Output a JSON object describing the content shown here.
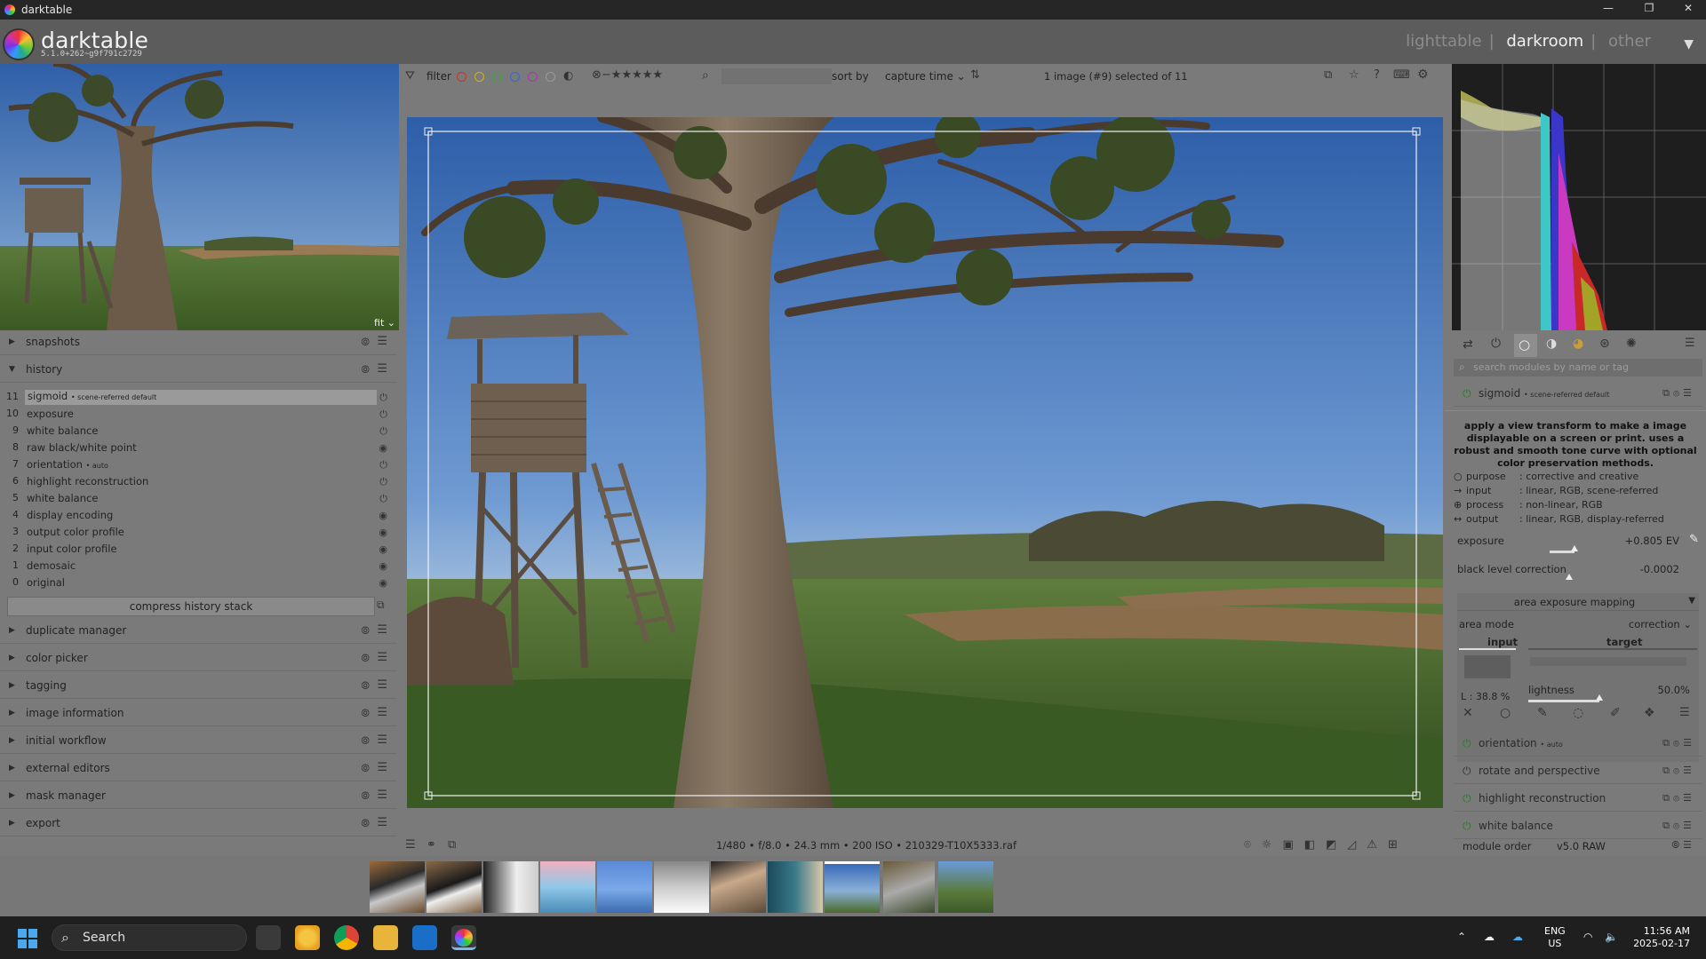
{
  "window": {
    "title": "darktable",
    "controls": [
      "—",
      "❐",
      "✕"
    ]
  },
  "header": {
    "app_name": "darktable",
    "version": "5.1.0+262~g9f791c2729",
    "views": [
      "lighttable",
      "darkroom",
      "other"
    ],
    "active_view": "darkroom"
  },
  "navigation": {
    "zoom": "fit"
  },
  "left_panel": {
    "modules_top": [
      {
        "label": "snapshots"
      },
      {
        "label": "history"
      }
    ],
    "history": [
      {
        "n": "11",
        "label": "sigmoid",
        "sub": "• scene-referred default"
      },
      {
        "n": "10",
        "label": "exposure",
        "sub": ""
      },
      {
        "n": "9",
        "label": "white balance",
        "sub": ""
      },
      {
        "n": "8",
        "label": "raw black/white point",
        "sub": ""
      },
      {
        "n": "7",
        "label": "orientation",
        "sub": "• auto"
      },
      {
        "n": "6",
        "label": "highlight reconstruction",
        "sub": ""
      },
      {
        "n": "5",
        "label": "white balance",
        "sub": ""
      },
      {
        "n": "4",
        "label": "display encoding",
        "sub": ""
      },
      {
        "n": "3",
        "label": "output color profile",
        "sub": ""
      },
      {
        "n": "2",
        "label": "input color profile",
        "sub": ""
      },
      {
        "n": "1",
        "label": "demosaic",
        "sub": ""
      },
      {
        "n": "0",
        "label": "original",
        "sub": ""
      }
    ],
    "compress_label": "compress history stack",
    "modules_bottom": [
      {
        "label": "duplicate manager"
      },
      {
        "label": "color picker"
      },
      {
        "label": "tagging"
      },
      {
        "label": "image information"
      },
      {
        "label": "initial workflow"
      },
      {
        "label": "external editors"
      },
      {
        "label": "mask manager"
      },
      {
        "label": "export"
      }
    ]
  },
  "toolbar": {
    "filter_label": "filter",
    "sort_label": "sort by",
    "sort_value": "capture time",
    "selection_info": "1 image (#9) selected of 11",
    "color_labels": [
      "#c0392b",
      "#c9b32a",
      "#3ea33e",
      "#3a66c9",
      "#a23aa8",
      "#9a9a9a"
    ]
  },
  "image_info": "1/480 • f/8.0 • 24.3 mm • 200 ISO • 210329-T10X5333.raf",
  "right_panel": {
    "search_placeholder": "search modules by name or tag",
    "expanded_module": {
      "name": "sigmoid",
      "preset": "• scene-referred default",
      "tooltip": "apply a view transform to make a image displayable on a screen or print. uses a robust and smooth tone curve with optional color preservation methods.",
      "info": [
        {
          "key": "purpose",
          "value": "corrective and creative"
        },
        {
          "key": "input",
          "value": "linear, RGB, scene-referred"
        },
        {
          "key": "process",
          "value": "non-linear, RGB"
        },
        {
          "key": "output",
          "value": "linear, RGB, display-referred"
        }
      ]
    },
    "exposure": {
      "label": "exposure",
      "value": "+0.805 EV",
      "level": 0.5
    },
    "black_level": {
      "label": "black level correction",
      "value": "-0.0002",
      "level": 0.5
    },
    "area_section": "area exposure mapping",
    "area_mode": {
      "label": "area mode",
      "value": "correction"
    },
    "input_label": "input",
    "target_label": "target",
    "input_lightness": "L : 38.8 %",
    "lightness": {
      "label": "lightness",
      "value": "50.0%",
      "level": 0.5
    },
    "modules": [
      {
        "label": "orientation",
        "sub": "• auto"
      },
      {
        "label": "rotate and perspective",
        "sub": ""
      },
      {
        "label": "highlight reconstruction",
        "sub": ""
      },
      {
        "label": "white balance",
        "sub": ""
      }
    ],
    "module_order_label": "module order",
    "module_order_value": "v5.0 RAW"
  },
  "taskbar": {
    "search_label": "Search",
    "lang_top": "ENG",
    "lang_bottom": "US",
    "time": "11:56 AM",
    "date": "2025-02-17"
  }
}
